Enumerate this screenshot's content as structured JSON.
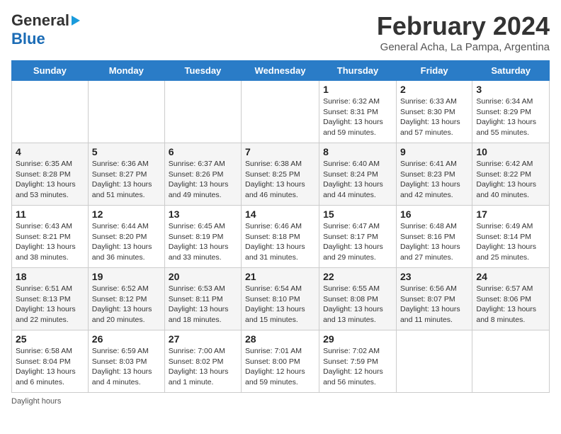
{
  "header": {
    "logo_general": "General",
    "logo_blue": "Blue",
    "title": "February 2024",
    "subtitle": "General Acha, La Pampa, Argentina"
  },
  "days_of_week": [
    "Sunday",
    "Monday",
    "Tuesday",
    "Wednesday",
    "Thursday",
    "Friday",
    "Saturday"
  ],
  "weeks": [
    [
      {
        "day": "",
        "info": ""
      },
      {
        "day": "",
        "info": ""
      },
      {
        "day": "",
        "info": ""
      },
      {
        "day": "",
        "info": ""
      },
      {
        "day": "1",
        "info": "Sunrise: 6:32 AM\nSunset: 8:31 PM\nDaylight: 13 hours and 59 minutes."
      },
      {
        "day": "2",
        "info": "Sunrise: 6:33 AM\nSunset: 8:30 PM\nDaylight: 13 hours and 57 minutes."
      },
      {
        "day": "3",
        "info": "Sunrise: 6:34 AM\nSunset: 8:29 PM\nDaylight: 13 hours and 55 minutes."
      }
    ],
    [
      {
        "day": "4",
        "info": "Sunrise: 6:35 AM\nSunset: 8:28 PM\nDaylight: 13 hours and 53 minutes."
      },
      {
        "day": "5",
        "info": "Sunrise: 6:36 AM\nSunset: 8:27 PM\nDaylight: 13 hours and 51 minutes."
      },
      {
        "day": "6",
        "info": "Sunrise: 6:37 AM\nSunset: 8:26 PM\nDaylight: 13 hours and 49 minutes."
      },
      {
        "day": "7",
        "info": "Sunrise: 6:38 AM\nSunset: 8:25 PM\nDaylight: 13 hours and 46 minutes."
      },
      {
        "day": "8",
        "info": "Sunrise: 6:40 AM\nSunset: 8:24 PM\nDaylight: 13 hours and 44 minutes."
      },
      {
        "day": "9",
        "info": "Sunrise: 6:41 AM\nSunset: 8:23 PM\nDaylight: 13 hours and 42 minutes."
      },
      {
        "day": "10",
        "info": "Sunrise: 6:42 AM\nSunset: 8:22 PM\nDaylight: 13 hours and 40 minutes."
      }
    ],
    [
      {
        "day": "11",
        "info": "Sunrise: 6:43 AM\nSunset: 8:21 PM\nDaylight: 13 hours and 38 minutes."
      },
      {
        "day": "12",
        "info": "Sunrise: 6:44 AM\nSunset: 8:20 PM\nDaylight: 13 hours and 36 minutes."
      },
      {
        "day": "13",
        "info": "Sunrise: 6:45 AM\nSunset: 8:19 PM\nDaylight: 13 hours and 33 minutes."
      },
      {
        "day": "14",
        "info": "Sunrise: 6:46 AM\nSunset: 8:18 PM\nDaylight: 13 hours and 31 minutes."
      },
      {
        "day": "15",
        "info": "Sunrise: 6:47 AM\nSunset: 8:17 PM\nDaylight: 13 hours and 29 minutes."
      },
      {
        "day": "16",
        "info": "Sunrise: 6:48 AM\nSunset: 8:16 PM\nDaylight: 13 hours and 27 minutes."
      },
      {
        "day": "17",
        "info": "Sunrise: 6:49 AM\nSunset: 8:14 PM\nDaylight: 13 hours and 25 minutes."
      }
    ],
    [
      {
        "day": "18",
        "info": "Sunrise: 6:51 AM\nSunset: 8:13 PM\nDaylight: 13 hours and 22 minutes."
      },
      {
        "day": "19",
        "info": "Sunrise: 6:52 AM\nSunset: 8:12 PM\nDaylight: 13 hours and 20 minutes."
      },
      {
        "day": "20",
        "info": "Sunrise: 6:53 AM\nSunset: 8:11 PM\nDaylight: 13 hours and 18 minutes."
      },
      {
        "day": "21",
        "info": "Sunrise: 6:54 AM\nSunset: 8:10 PM\nDaylight: 13 hours and 15 minutes."
      },
      {
        "day": "22",
        "info": "Sunrise: 6:55 AM\nSunset: 8:08 PM\nDaylight: 13 hours and 13 minutes."
      },
      {
        "day": "23",
        "info": "Sunrise: 6:56 AM\nSunset: 8:07 PM\nDaylight: 13 hours and 11 minutes."
      },
      {
        "day": "24",
        "info": "Sunrise: 6:57 AM\nSunset: 8:06 PM\nDaylight: 13 hours and 8 minutes."
      }
    ],
    [
      {
        "day": "25",
        "info": "Sunrise: 6:58 AM\nSunset: 8:04 PM\nDaylight: 13 hours and 6 minutes."
      },
      {
        "day": "26",
        "info": "Sunrise: 6:59 AM\nSunset: 8:03 PM\nDaylight: 13 hours and 4 minutes."
      },
      {
        "day": "27",
        "info": "Sunrise: 7:00 AM\nSunset: 8:02 PM\nDaylight: 13 hours and 1 minute."
      },
      {
        "day": "28",
        "info": "Sunrise: 7:01 AM\nSunset: 8:00 PM\nDaylight: 12 hours and 59 minutes."
      },
      {
        "day": "29",
        "info": "Sunrise: 7:02 AM\nSunset: 7:59 PM\nDaylight: 12 hours and 56 minutes."
      },
      {
        "day": "",
        "info": ""
      },
      {
        "day": "",
        "info": ""
      }
    ]
  ],
  "footer": {
    "daylight_label": "Daylight hours"
  }
}
